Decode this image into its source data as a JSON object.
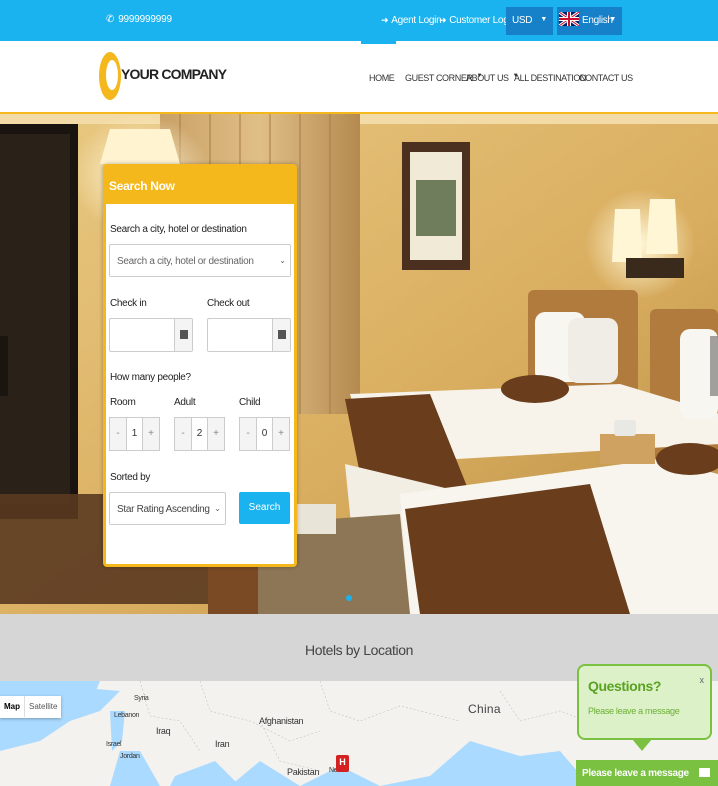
{
  "topbar": {
    "phone": "9999999999",
    "agent_login": "Agent Login",
    "customer_login": "Customer Login",
    "currency": "USD",
    "language": "English"
  },
  "header": {
    "logo_text": "YOUR COMPANY",
    "nav": [
      {
        "label": "HOME",
        "dropdown": false,
        "active": true
      },
      {
        "label": "GUEST CORNER",
        "dropdown": true
      },
      {
        "label": "ABOUT US",
        "dropdown": true
      },
      {
        "label": "ALL DESTINATION",
        "dropdown": false
      },
      {
        "label": "CONTACT US",
        "dropdown": false
      }
    ]
  },
  "search": {
    "title": "Search Now",
    "destination_label": "Search a city, hotel or destination",
    "destination_placeholder": "Search a city, hotel or destination",
    "checkin_label": "Check in",
    "checkout_label": "Check out",
    "people_label": "How many people?",
    "room_label": "Room",
    "adult_label": "Adult",
    "child_label": "Child",
    "room_value": "1",
    "adult_value": "2",
    "child_value": "0",
    "minus": "-",
    "plus": "+",
    "sorted_label": "Sorted by",
    "sorted_value": "Star Rating Ascending",
    "search_button": "Search"
  },
  "locations": {
    "title": "Hotels by Location",
    "map_tab_map": "Map",
    "map_tab_satellite": "Satellite",
    "labels": {
      "syria": "Syria",
      "lebanon": "Lebanon",
      "israel": "Israel",
      "jordan": "Jordan",
      "iraq": "Iraq",
      "iran": "Iran",
      "afghanistan": "Afghanistan",
      "pakistan": "Pakistan",
      "nepal": "Ne",
      "china": "China"
    },
    "pin_label": "H"
  },
  "chat": {
    "title": "Questions?",
    "subtitle": "Please leave a message",
    "close": "x",
    "bar_label": "Please leave a message"
  },
  "colors": {
    "topbar": "#1ab3ef",
    "accent": "#f5b81c",
    "search_button": "#1ab3ef",
    "chat_green": "#7ac142"
  }
}
